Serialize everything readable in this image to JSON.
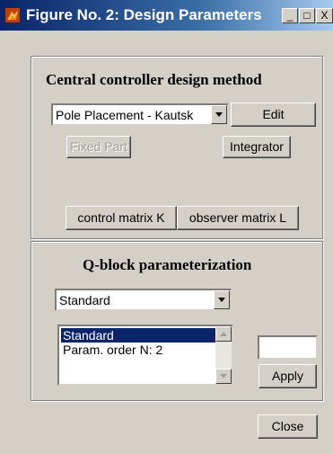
{
  "window": {
    "title": "Figure No. 2: Design Parameters",
    "controls": {
      "minimize": "_",
      "maximize": "□",
      "close": "X"
    }
  },
  "controller_panel": {
    "title": "Central controller design method",
    "method_select": "Pole Placement - Kautsk",
    "edit_button": "Edit",
    "fixed_part_button": "Fixed Part",
    "integrator_button": "Integrator",
    "control_matrix_button": "control matrix K",
    "observer_matrix_button": "observer matrix L"
  },
  "qblock_panel": {
    "title": "Q-block parameterization",
    "type_select": "Standard",
    "list_items": [
      "Standard",
      "Param. order N: 2"
    ],
    "selected_index": 0,
    "value_input": "",
    "apply_button": "Apply"
  },
  "close_button": "Close"
}
